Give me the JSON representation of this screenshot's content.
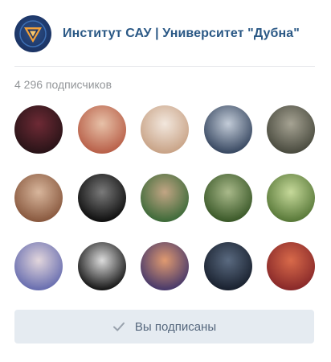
{
  "group": {
    "name": "Институт САУ | Университет \"Дубна\"",
    "logo_icon": "triangle-emblem-icon"
  },
  "subscribers": {
    "count_text": "4 296 подписчиков"
  },
  "avatars": [
    {
      "name": "subscriber-1",
      "c1": "#2a1418",
      "c2": "#6e2a35"
    },
    {
      "name": "subscriber-2",
      "c1": "#b9614a",
      "c2": "#e7c1a8"
    },
    {
      "name": "subscriber-3",
      "c1": "#c9a488",
      "c2": "#f2e7dd"
    },
    {
      "name": "subscriber-4",
      "c1": "#3a4a63",
      "c2": "#c3ccd8"
    },
    {
      "name": "subscriber-5",
      "c1": "#4b4c40",
      "c2": "#a6a393"
    },
    {
      "name": "subscriber-6",
      "c1": "#8a5a40",
      "c2": "#d8b69c"
    },
    {
      "name": "subscriber-7",
      "c1": "#111111",
      "c2": "#7a7a7a"
    },
    {
      "name": "subscriber-8",
      "c1": "#3f6b3a",
      "c2": "#c2a584"
    },
    {
      "name": "subscriber-9",
      "c1": "#3c5a2a",
      "c2": "#a9b98a"
    },
    {
      "name": "subscriber-10",
      "c1": "#5a7a3a",
      "c2": "#c6d99a"
    },
    {
      "name": "subscriber-11",
      "c1": "#6a6fb0",
      "c2": "#e2d6dc"
    },
    {
      "name": "subscriber-12",
      "c1": "#1a1a1a",
      "c2": "#dcdcdc"
    },
    {
      "name": "subscriber-13",
      "c1": "#4a3a6a",
      "c2": "#e09a70"
    },
    {
      "name": "subscriber-14",
      "c1": "#1a2230",
      "c2": "#5a6a80"
    },
    {
      "name": "subscriber-15",
      "c1": "#8a2a2a",
      "c2": "#d86a4a"
    }
  ],
  "button": {
    "label": "Вы подписаны",
    "icon": "check-icon"
  },
  "colors": {
    "link": "#2a5885",
    "muted": "#939699",
    "button_bg": "#e5ebf1",
    "button_text": "#55677d"
  }
}
